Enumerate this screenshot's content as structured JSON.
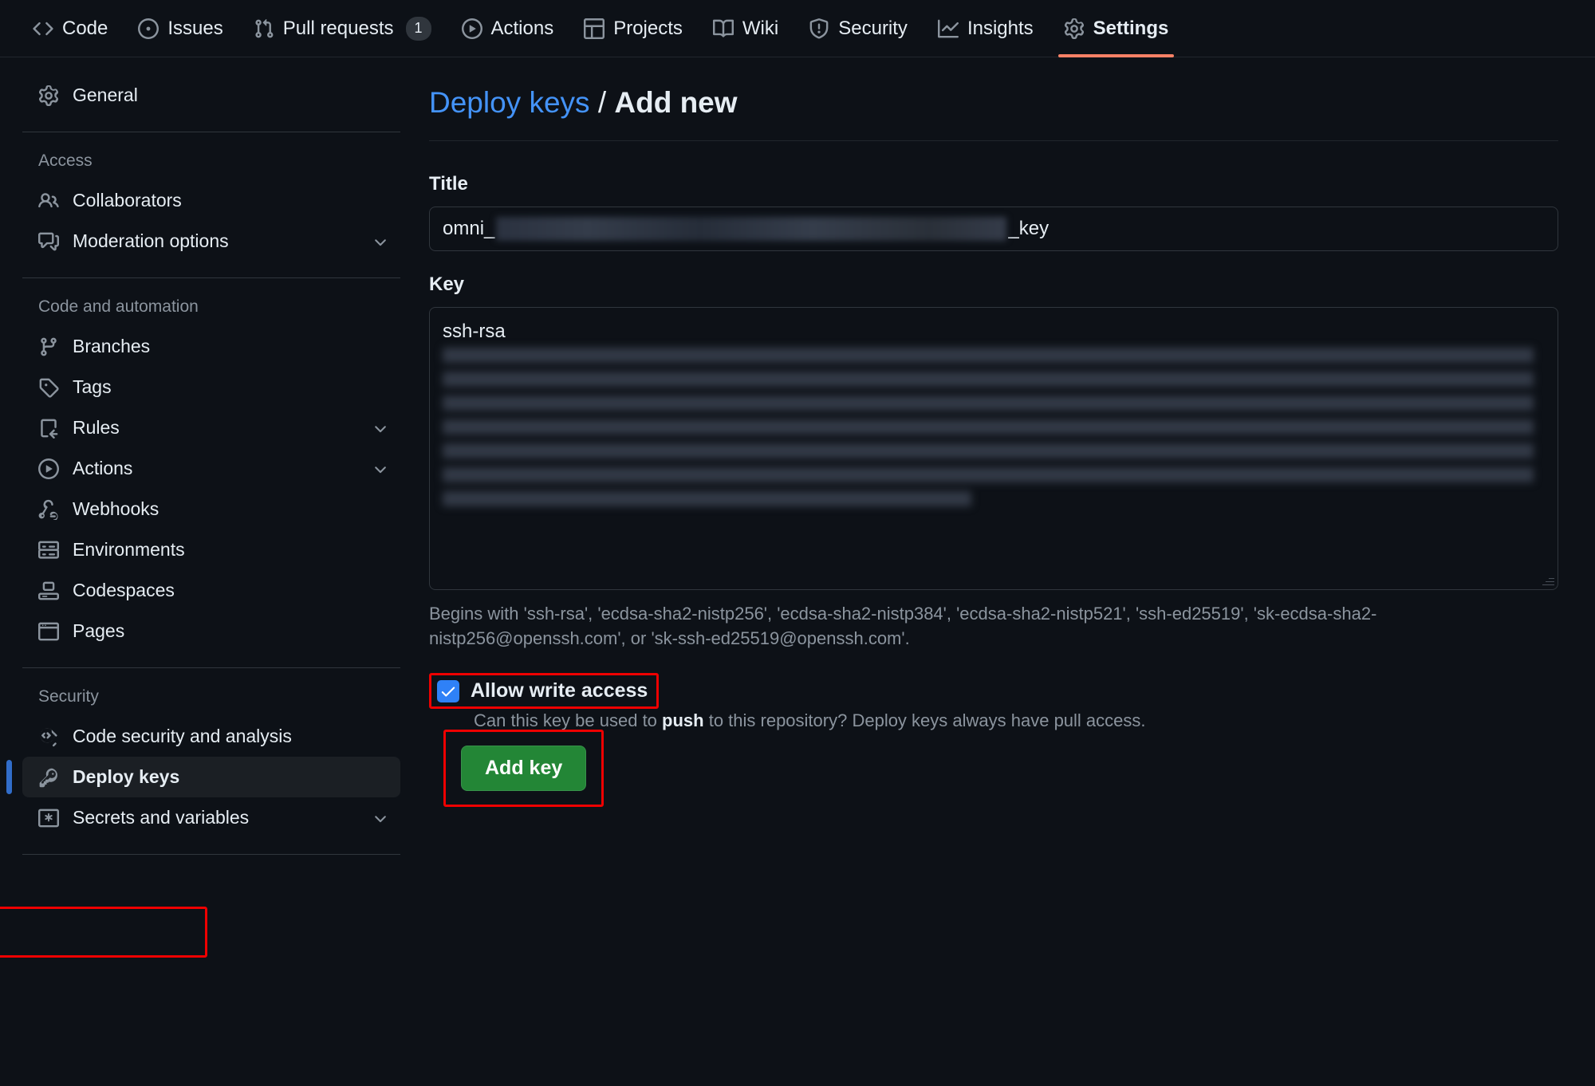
{
  "topnav": {
    "items": [
      {
        "label": "Code",
        "icon": "code-icon",
        "active": false,
        "counter": null
      },
      {
        "label": "Issues",
        "icon": "issue-opened-icon",
        "active": false,
        "counter": null
      },
      {
        "label": "Pull requests",
        "icon": "git-pull-request-icon",
        "active": false,
        "counter": "1"
      },
      {
        "label": "Actions",
        "icon": "play-icon",
        "active": false,
        "counter": null
      },
      {
        "label": "Projects",
        "icon": "table-icon",
        "active": false,
        "counter": null
      },
      {
        "label": "Wiki",
        "icon": "book-icon",
        "active": false,
        "counter": null
      },
      {
        "label": "Security",
        "icon": "shield-icon",
        "active": false,
        "counter": null
      },
      {
        "label": "Insights",
        "icon": "graph-icon",
        "active": false,
        "counter": null
      },
      {
        "label": "Settings",
        "icon": "gear-icon",
        "active": true,
        "counter": null
      }
    ]
  },
  "sidebar": {
    "general": {
      "label": "General",
      "icon": "gear-icon"
    },
    "groups": [
      {
        "title": "Access",
        "items": [
          {
            "label": "Collaborators",
            "icon": "people-icon",
            "chevron": false
          },
          {
            "label": "Moderation options",
            "icon": "comment-discussion-icon",
            "chevron": true
          }
        ]
      },
      {
        "title": "Code and automation",
        "items": [
          {
            "label": "Branches",
            "icon": "git-branch-icon",
            "chevron": false
          },
          {
            "label": "Tags",
            "icon": "tag-icon",
            "chevron": false
          },
          {
            "label": "Rules",
            "icon": "rules-icon",
            "chevron": true
          },
          {
            "label": "Actions",
            "icon": "play-icon",
            "chevron": true
          },
          {
            "label": "Webhooks",
            "icon": "webhook-icon",
            "chevron": false
          },
          {
            "label": "Environments",
            "icon": "server-icon",
            "chevron": false
          },
          {
            "label": "Codespaces",
            "icon": "codespaces-icon",
            "chevron": false
          },
          {
            "label": "Pages",
            "icon": "browser-icon",
            "chevron": false
          }
        ]
      },
      {
        "title": "Security",
        "items": [
          {
            "label": "Code security and analysis",
            "icon": "codescan-icon",
            "chevron": false
          },
          {
            "label": "Deploy keys",
            "icon": "key-icon",
            "chevron": false,
            "selected": true
          },
          {
            "label": "Secrets and variables",
            "icon": "asterisk-key-icon",
            "chevron": true
          }
        ]
      }
    ]
  },
  "main": {
    "breadcrumb": {
      "link": "Deploy keys",
      "separator": "/",
      "current": "Add new"
    },
    "title_field": {
      "label": "Title",
      "value_prefix": "omni_",
      "value_suffix": "_key",
      "redacted": true
    },
    "key_field": {
      "label": "Key",
      "value_prefix": "ssh-rsa",
      "redacted": true,
      "help": "Begins with 'ssh-rsa', 'ecdsa-sha2-nistp256', 'ecdsa-sha2-nistp384', 'ecdsa-sha2-nistp521', 'ssh-ed25519', 'sk-ecdsa-sha2-nistp256@openssh.com', or 'sk-ssh-ed25519@openssh.com'."
    },
    "allow_write": {
      "label": "Allow write access",
      "checked": true,
      "help_before": "Can this key be used to ",
      "help_bold": "push",
      "help_after": " to this repository? Deploy keys always have pull access."
    },
    "submit": {
      "label": "Add key"
    }
  },
  "colors": {
    "accent_blue": "#4493f8",
    "active_tab_underline": "#f78166",
    "checkbox_blue": "#2f81f7",
    "submit_green": "#238636",
    "annotation_red": "#ee0000",
    "selected_bar_blue": "#316dca"
  }
}
